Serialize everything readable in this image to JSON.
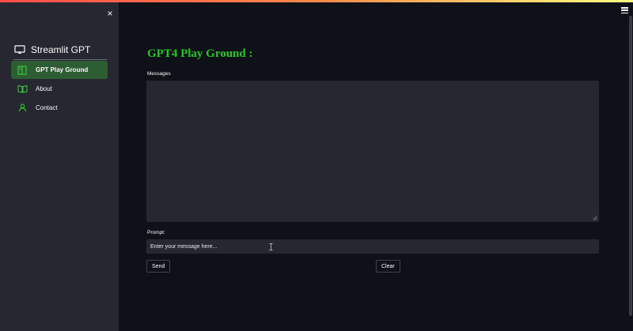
{
  "colors": {
    "background": "#0e1117",
    "sidebar": "#262730",
    "accent_green": "#1fc91f",
    "active_item_bg": "#2d5e33"
  },
  "sidebar": {
    "close_icon": "×",
    "brand": {
      "icon": "monitor-icon",
      "title": "Streamlit GPT"
    },
    "items": [
      {
        "label": "GPT Play Ground",
        "icon": "book-open-icon",
        "active": true
      },
      {
        "label": "About",
        "icon": "book-icon",
        "active": false
      },
      {
        "label": "Contact",
        "icon": "person-icon",
        "active": false
      }
    ]
  },
  "header": {
    "menu_icon": "hamburger-icon"
  },
  "main": {
    "title": "GPT4 Play Ground :",
    "messages_label": "Messages",
    "messages_value": "",
    "prompt_label": "Prompt:",
    "prompt_value": "Enter your message here...",
    "send_label": "Send",
    "clear_label": "Clear"
  }
}
